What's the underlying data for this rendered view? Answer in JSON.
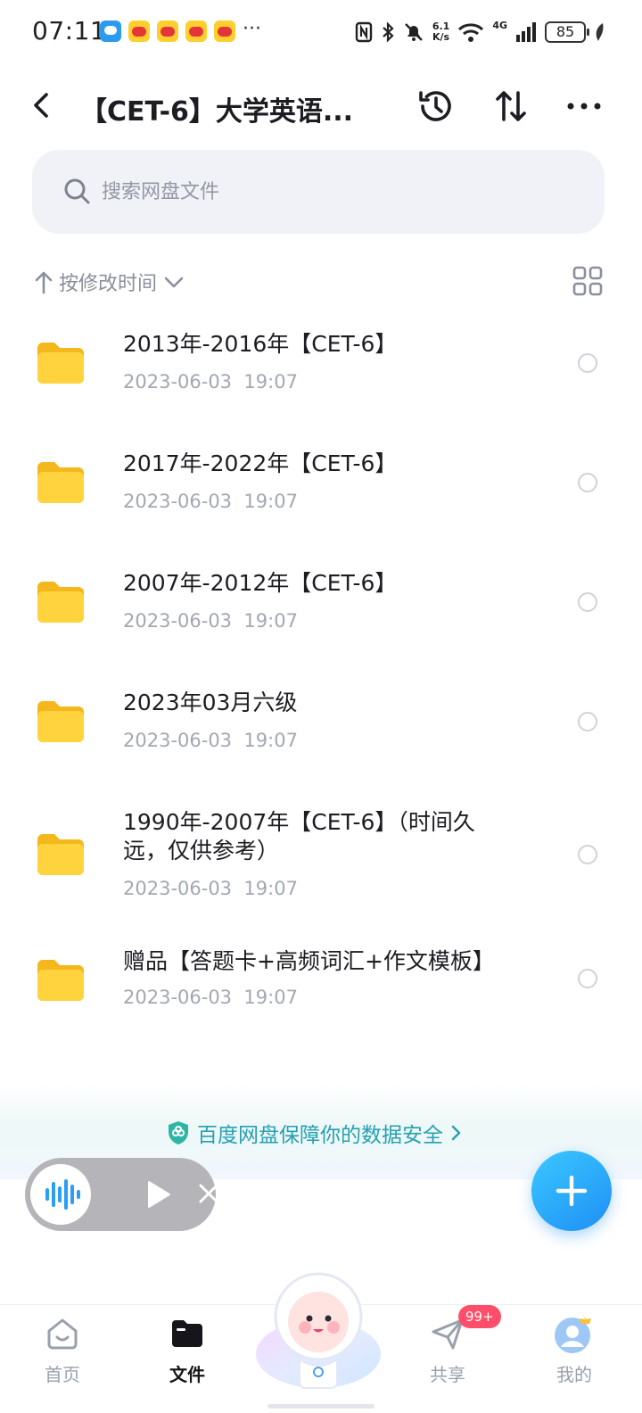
{
  "status_bar": {
    "time": "07:11",
    "overflow": "···",
    "net_speed_value": "6.1",
    "net_speed_unit": "K/s",
    "network_type": "4G",
    "battery": "85"
  },
  "header": {
    "title": "【CET-6】大学英语...",
    "back_icon": "back-chevron-icon",
    "actions": [
      "history-icon",
      "sort-updown-icon",
      "more-icon"
    ]
  },
  "search": {
    "placeholder": "搜索网盘文件"
  },
  "sort": {
    "label": "按修改时间",
    "direction": "ascending"
  },
  "files": [
    {
      "name": "2013年-2016年【CET-6】",
      "date": "2023-06-03",
      "time": "19:07"
    },
    {
      "name": "2017年-2022年【CET-6】",
      "date": "2023-06-03",
      "time": "19:07"
    },
    {
      "name": "2007年-2012年【CET-6】",
      "date": "2023-06-03",
      "time": "19:07"
    },
    {
      "name": "2023年03月六级",
      "date": "2023-06-03",
      "time": "19:07"
    },
    {
      "name": "1990年-2007年【CET-6】（时间久远，仅供参考）",
      "date": "2023-06-03",
      "time": "19:07"
    },
    {
      "name": "赠品【答题卡+高频词汇+作文模板】",
      "date": "2023-06-03",
      "time": "19:07"
    }
  ],
  "safety_banner": {
    "text": "百度网盘保障你的数据安全"
  },
  "tabs": [
    {
      "label": "首页",
      "icon": "home-icon",
      "active": false
    },
    {
      "label": "文件",
      "icon": "folder-icon",
      "active": true
    },
    {
      "label": "共享",
      "icon": "send-icon",
      "active": false,
      "badge": "99+"
    },
    {
      "label": "我的",
      "icon": "profile-icon",
      "active": false
    }
  ],
  "colors": {
    "accent": "#1e8ff5",
    "folder": "#ffc927",
    "safety_text": "#25a0b2",
    "badge": "#ff4d6a"
  }
}
